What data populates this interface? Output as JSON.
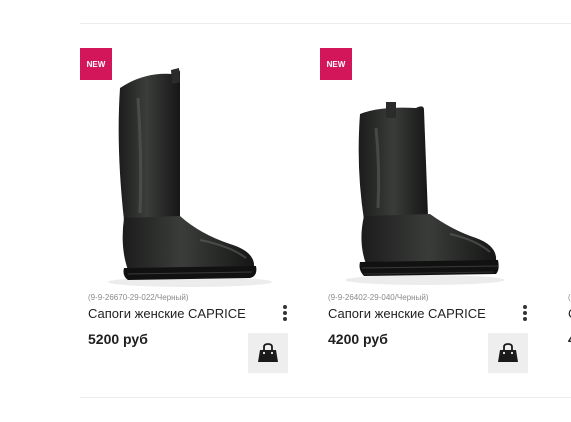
{
  "products": [
    {
      "badge": "NEW",
      "sku": "(9-9-26670-29-022/Черный)",
      "name": "Сапоги женские CAPRICE",
      "price": "5200 руб",
      "image_icon": "tall-black-boot"
    },
    {
      "badge": "NEW",
      "sku": "(9-9-26402-29-040/Черный)",
      "name": "Сапоги женские CAPRICE",
      "price": "4200 руб",
      "image_icon": "mid-black-boot"
    },
    {
      "sku": "(",
      "name": "С",
      "price": "4"
    }
  ],
  "icons": {
    "more": "vertical-dots-icon",
    "cart": "shopping-bag-icon"
  },
  "colors": {
    "badge_bg": "#d3165a",
    "cart_button_bg": "#eeeeee"
  }
}
